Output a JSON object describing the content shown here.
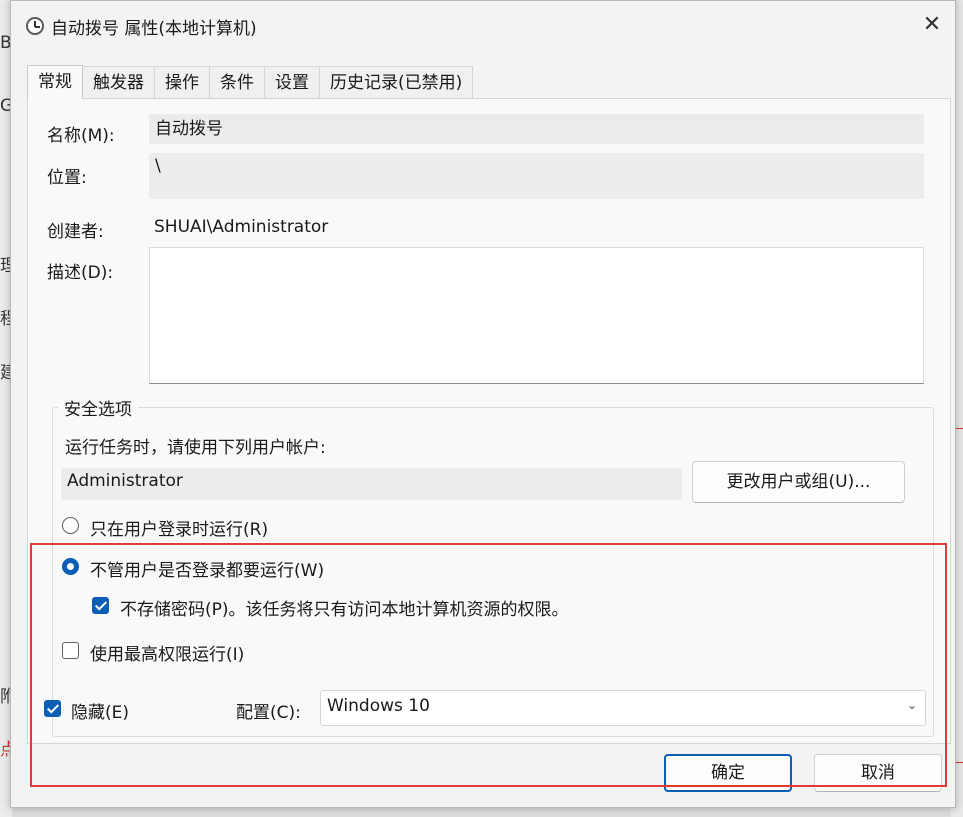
{
  "background": {
    "chars": [
      "Be",
      "G",
      "理",
      "程",
      "建",
      "附",
      "点"
    ]
  },
  "window": {
    "title": "自动拨号 属性(本地计算机)",
    "close_symbol": "✕"
  },
  "tabs": [
    {
      "label": "常规",
      "active": true
    },
    {
      "label": "触发器",
      "active": false
    },
    {
      "label": "操作",
      "active": false
    },
    {
      "label": "条件",
      "active": false
    },
    {
      "label": "设置",
      "active": false
    },
    {
      "label": "历史记录(已禁用)",
      "active": false
    }
  ],
  "general": {
    "name_label": "名称(M):",
    "name_value": "自动拨号",
    "location_label": "位置:",
    "location_value": "\\",
    "author_label": "创建者:",
    "author_value": "SHUAI\\Administrator",
    "description_label": "描述(D):",
    "description_value": ""
  },
  "security": {
    "legend": "安全选项",
    "run_as_label": "运行任务时，请使用下列用户帐户:",
    "user_account": "Administrator",
    "change_user_button": "更改用户或组(U)...",
    "radio_logged_on": "只在用户登录时运行(R)",
    "radio_whether_logged": "不管用户是否登录都要运行(W)",
    "selected_radio": "whether_logged",
    "do_not_store_password": "不存储密码(P)。该任务将只有访问本地计算机资源的权限。",
    "do_not_store_password_checked": true,
    "highest_privileges": "使用最高权限运行(I)",
    "highest_privileges_checked": false
  },
  "hidden_label": "隐藏(E)",
  "hidden_checked": true,
  "configure_label": "配置(C):",
  "configure_value": "Windows 10",
  "buttons": {
    "ok": "确定",
    "cancel": "取消"
  },
  "colors": {
    "accent": "#0a5fb4",
    "highlight": "#e03a3a"
  }
}
